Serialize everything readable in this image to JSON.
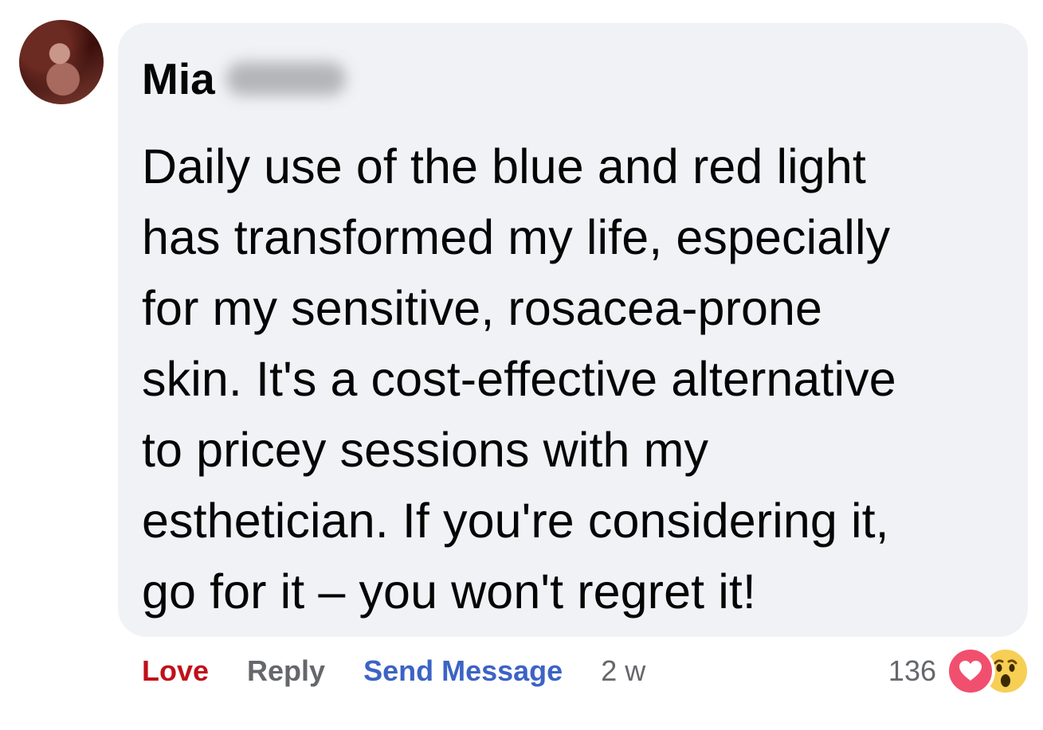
{
  "comment": {
    "author": {
      "first_name": "Mia",
      "last_name_redacted": true
    },
    "text": "Daily use of the blue and red light\nhas transformed my life, especially\nfor my sensitive, rosacea-prone\nskin. It's a cost-effective alternative\nto pricey sessions with my\nesthetician. If you're considering it,\ngo for it – you won't regret it!",
    "actions": {
      "love_label": "Love",
      "reply_label": "Reply",
      "send_message_label": "Send Message",
      "timestamp": "2 w"
    },
    "reactions": {
      "count": "136",
      "types": [
        "love-icon",
        "wow-icon"
      ]
    }
  },
  "colors": {
    "bubble_background": "#f0f2f5",
    "love_red": "#c0101a",
    "link_blue": "#3c63c5",
    "secondary_text": "#65676b",
    "love_reaction": "#f0506e",
    "wow_reaction": "#f7cf55"
  }
}
